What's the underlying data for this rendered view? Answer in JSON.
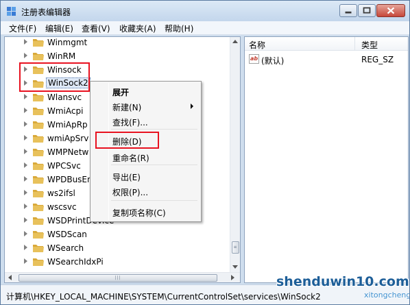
{
  "window": {
    "title": "注册表编辑器",
    "controls": {
      "minimize": "minimize",
      "maximize": "maximize",
      "close": "close"
    }
  },
  "menu": [
    "文件(F)",
    "编辑(E)",
    "查看(V)",
    "收藏夹(A)",
    "帮助(H)"
  ],
  "tree": {
    "items": [
      {
        "label": "Winmgmt"
      },
      {
        "label": "WinRM"
      },
      {
        "label": "Winsock"
      },
      {
        "label": "WinSock2",
        "selected": true
      },
      {
        "label": "Wlansvc"
      },
      {
        "label": "WmiAcpi"
      },
      {
        "label": "WmiApRp"
      },
      {
        "label": "wmiApSrv"
      },
      {
        "label": "WMPNetw"
      },
      {
        "label": "WPCSvc"
      },
      {
        "label": "WPDBusEn"
      },
      {
        "label": "ws2ifsl"
      },
      {
        "label": "wscsvc"
      },
      {
        "label": "WSDPrintDevice"
      },
      {
        "label": "WSDScan"
      },
      {
        "label": "WSearch"
      },
      {
        "label": "WSearchIdxPi"
      }
    ]
  },
  "values": {
    "headers": {
      "name": "名称",
      "type": "类型"
    },
    "rows": [
      {
        "icon": "ab-string-icon",
        "name": "(默认)",
        "type": "REG_SZ"
      }
    ]
  },
  "context_menu": {
    "items": [
      {
        "label": "展开",
        "bold": true
      },
      {
        "label": "新建(N)",
        "submenu": true
      },
      {
        "label": "查找(F)..."
      },
      {
        "label": "删除(D)",
        "highlighted": true
      },
      {
        "label": "重命名(R)"
      },
      {
        "label": "导出(E)"
      },
      {
        "label": "权限(P)..."
      },
      {
        "label": "复制项名称(C)"
      }
    ]
  },
  "status_bar": {
    "path": "计算机\\HKEY_LOCAL_MACHINE\\SYSTEM\\CurrentControlSet\\services\\WinSock2"
  },
  "watermark": {
    "main": "shenduwin10.com",
    "sub": "xitongcheng.com"
  },
  "colors": {
    "highlight_box": "#e8111f",
    "folder": "#e8c15b",
    "window_chrome": "#cfdeee"
  }
}
